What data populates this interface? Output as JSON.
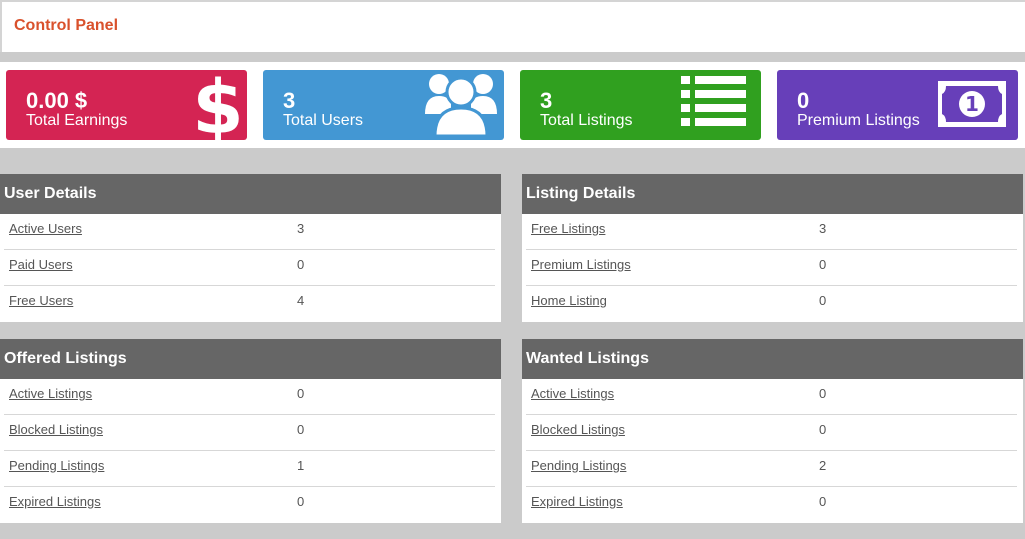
{
  "header": {
    "title": "Control Panel"
  },
  "stats": [
    {
      "value": "0.00 $",
      "label": "Total Earnings",
      "color": "#d42453",
      "icon": "dollar-sign-icon"
    },
    {
      "value": "3",
      "label": "Total Users",
      "color": "#4397d3",
      "icon": "users-icon"
    },
    {
      "value": "3",
      "label": "Total Listings",
      "color": "#30a01f",
      "icon": "list-icon"
    },
    {
      "value": "0",
      "label": "Premium Listings",
      "color": "#673fb9",
      "icon": "banknote-icon"
    }
  ],
  "panels": {
    "user_details": {
      "title": "User Details",
      "rows": [
        {
          "label": "Active Users",
          "value": "3"
        },
        {
          "label": "Paid Users",
          "value": "0"
        },
        {
          "label": "Free Users",
          "value": "4"
        }
      ]
    },
    "listing_details": {
      "title": "Listing Details",
      "rows": [
        {
          "label": "Free Listings",
          "value": "3"
        },
        {
          "label": "Premium Listings",
          "value": "0"
        },
        {
          "label": "Home Listing",
          "value": "0"
        }
      ]
    },
    "offered_listings": {
      "title": "Offered Listings",
      "rows": [
        {
          "label": "Active Listings",
          "value": "0"
        },
        {
          "label": "Blocked Listings",
          "value": "0"
        },
        {
          "label": "Pending Listings",
          "value": "1"
        },
        {
          "label": "Expired Listings",
          "value": "0"
        }
      ]
    },
    "wanted_listings": {
      "title": "Wanted Listings",
      "rows": [
        {
          "label": "Active Listings",
          "value": "0"
        },
        {
          "label": "Blocked Listings",
          "value": "0"
        },
        {
          "label": "Pending Listings",
          "value": "2"
        },
        {
          "label": "Expired Listings",
          "value": "0"
        }
      ]
    }
  }
}
